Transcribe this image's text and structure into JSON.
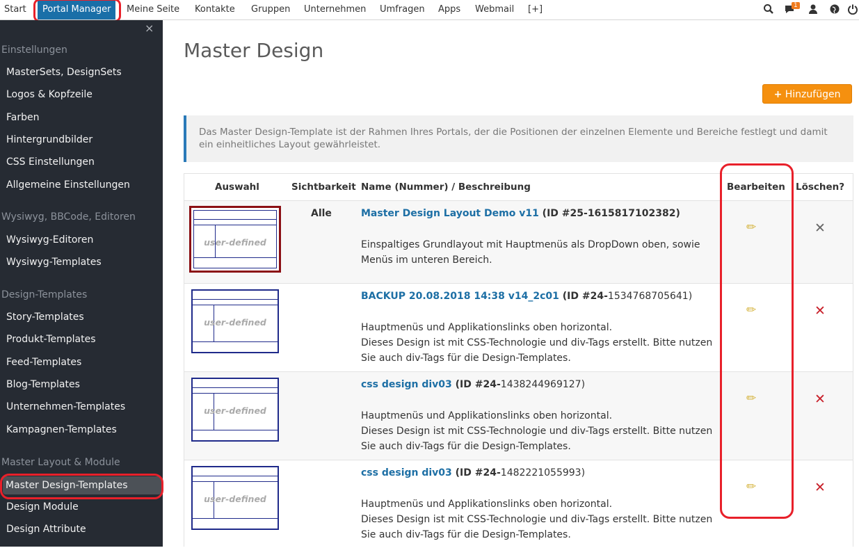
{
  "topnav": {
    "items": [
      "Start",
      "Portal Manager",
      "Meine Seite",
      "Kontakte",
      "Gruppen",
      "Unternehmen",
      "Umfragen",
      "Apps",
      "Webmail",
      "[+]"
    ],
    "active_index": 1,
    "notification_count": "1",
    "icons": [
      "search-icon",
      "chat-icon",
      "user-icon",
      "globe-icon",
      "power-icon"
    ]
  },
  "sidebar": {
    "close_glyph": "×",
    "sections": [
      {
        "label": "Einstellungen",
        "items": [
          "MasterSets, DesignSets",
          "Logos & Kopfzeile",
          "Farben",
          "Hintergrundbilder",
          "CSS Einstellungen",
          "Allgemeine Einstellungen"
        ]
      },
      {
        "label": "Wysiwyg, BBCode, Editoren",
        "items": [
          "Wysiwyg-Editoren",
          "Wysiwyg-Templates"
        ]
      },
      {
        "label": "Design-Templates",
        "items": [
          "Story-Templates",
          "Produkt-Templates",
          "Feed-Templates",
          "Blog-Templates",
          "Unternehmen-Templates",
          "Kampagnen-Templates"
        ]
      },
      {
        "label": "Master Layout & Module",
        "items": [
          "Master Design-Templates",
          "Design Module",
          "Design Attribute"
        ]
      }
    ],
    "active_item": "Master Design-Templates"
  },
  "main": {
    "title": "Master Design",
    "add_button": "Hinzufügen",
    "info": "Das Master Design-Template ist der Rahmen Ihres Portals, der die Positionen der einzelnen Elemente und Bereiche festlegt und damit ein einheitliches Layout gewährleistet.",
    "table": {
      "headers": {
        "select": "Auswahl",
        "visibility": "Sichtbarkeit",
        "name": "Name (Nummer) / Beschreibung",
        "edit": "Bearbeiten",
        "delete": "Löschen?"
      },
      "thumb_label": "user-defined",
      "rows": [
        {
          "selected": true,
          "visibility": "Alle",
          "name": "Master Design Layout Demo v11",
          "id_prefix": " (ID #25-",
          "id_num": "1615817102382",
          "id_suffix": ")",
          "id_bold": true,
          "desc": [
            "Einspaltiges Grundlayout mit Hauptmenüs als DropDown oben, sowie Menüs im unteren Bereich."
          ],
          "delete_active": false
        },
        {
          "selected": false,
          "visibility": "",
          "name": "BACKUP 20.08.2018 14:38 v14_2c01",
          "id_prefix": " (ID #24-",
          "id_num": "1534768705641",
          "id_suffix": ")",
          "id_bold": false,
          "desc": [
            "Hauptmenüs und Applikationslinks oben horizontal.",
            "Dieses Design ist mit CSS-Technologie und div-Tags erstellt. Bitte nutzen Sie auch div-Tags für die Design-Templates."
          ],
          "delete_active": true
        },
        {
          "selected": false,
          "visibility": "",
          "name": "css design div03",
          "id_prefix": " (ID #24-",
          "id_num": "1438244969127",
          "id_suffix": ")",
          "id_bold": false,
          "desc": [
            "Hauptmenüs und Applikationslinks oben horizontal.",
            "Dieses Design ist mit CSS-Technologie und div-Tags erstellt. Bitte nutzen Sie auch div-Tags für die Design-Templates."
          ],
          "delete_active": true
        },
        {
          "selected": false,
          "visibility": "",
          "name": "css design div03",
          "id_prefix": " (ID #24-",
          "id_num": "1482221055993",
          "id_suffix": ")",
          "id_bold": false,
          "desc": [
            "Hauptmenüs und Applikationslinks oben horizontal.",
            "Dieses Design ist mit CSS-Technologie und div-Tags erstellt. Bitte nutzen Sie auch div-Tags für die Design-Templates."
          ],
          "delete_active": true
        }
      ]
    }
  },
  "colors": {
    "accent": "#1a6fa8",
    "highlight": "#e8202a",
    "add_button": "#f5900f",
    "delete_active": "#c8202a",
    "delete_inactive": "#666666"
  }
}
